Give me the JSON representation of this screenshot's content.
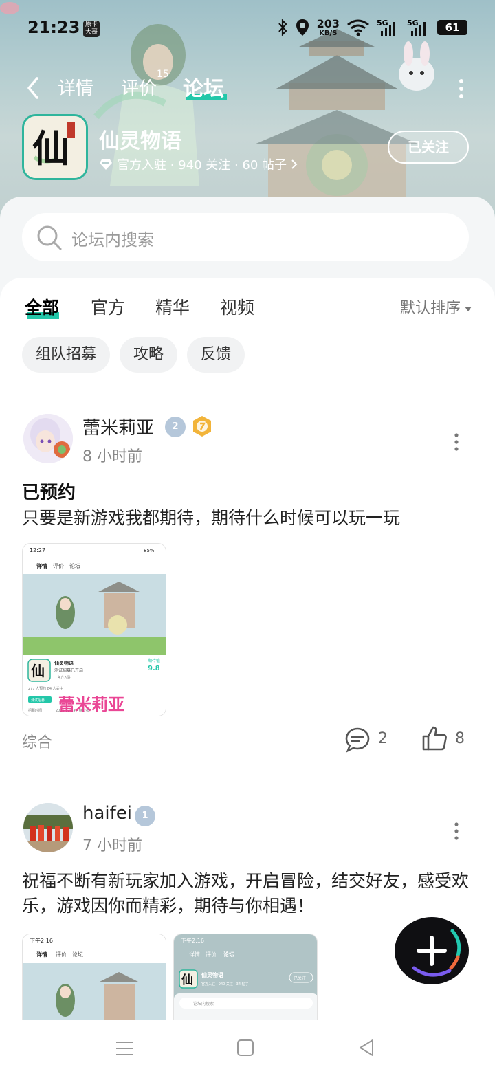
{
  "status_bar": {
    "time": "21:23",
    "badge": "原卡大哥",
    "net_speed_value": "203",
    "net_speed_unit": "KB/S",
    "battery": "61"
  },
  "top_nav": {
    "tabs": [
      {
        "label": "详情"
      },
      {
        "label": "评价",
        "count": "15"
      },
      {
        "label": "论坛",
        "active": true
      }
    ]
  },
  "game": {
    "title": "仙灵物语",
    "meta": "官方入驻 · 940 关注 · 60 帖子",
    "icon_char": "仙",
    "follow_label": "已关注"
  },
  "search": {
    "placeholder": "论坛内搜索"
  },
  "filter_tabs": [
    "全部",
    "官方",
    "精华",
    "视频"
  ],
  "sort_label": "默认排序",
  "chips": [
    "组队招募",
    "攻略",
    "反馈"
  ],
  "posts": [
    {
      "username": "蕾米莉亚",
      "level": "2",
      "time": "8 小时前",
      "title": "已预约",
      "body": "只要是新游戏我都期待，期待什么时候可以玩一玩",
      "category": "综合",
      "comments": "2",
      "likes": "8",
      "thumbs": [
        {
          "time": "12:27",
          "battery": "85%",
          "tabs": [
            "详情",
            "评价",
            "论坛"
          ],
          "game_title": "仙灵物语",
          "subtitle": "测试招募已开启",
          "official": "官方入驻",
          "score_label": "期待值",
          "score": "9.8",
          "stats": "277 人预约   84 人关注",
          "tag": "测试招募",
          "row_label": "招募时间",
          "row_value": "2025/12/14 - 待公布",
          "watermark": "蕾米莉亚"
        }
      ]
    },
    {
      "username": "haifei",
      "level": "1",
      "time": "7 小时前",
      "body": "祝福不断有新玩家加入游戏，开启冒险，结交好友，感受欢乐，游戏因你而精彩，期待与你相遇！",
      "thumbs": [
        {
          "time": "下午2:16",
          "tabs": [
            "详情",
            "评价",
            "论坛"
          ]
        },
        {
          "time": "下午2:16",
          "tabs": [
            "详情",
            "评价",
            "论坛"
          ],
          "game_title": "仙灵物语",
          "meta": "官方入驻 · 940 关注 · 34 帖子",
          "follow": "已关注",
          "search": "论坛内搜索"
        }
      ]
    }
  ],
  "colors": {
    "accent": "#23c7a9",
    "header_bg": "#b7cfd1"
  }
}
